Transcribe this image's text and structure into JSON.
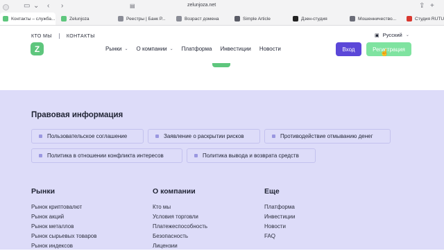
{
  "browser": {
    "url": "zelunjoza.net",
    "tabs": [
      {
        "label": "Контакты – служба...",
        "color": "#5ec67d",
        "active": true
      },
      {
        "label": "Zelunjoza",
        "color": "#5ec67d",
        "active": false
      },
      {
        "label": "Реестры | Банк Р...",
        "color": "#8a8c96",
        "active": false
      },
      {
        "label": "Возраст домена",
        "color": "#8a8c96",
        "active": false
      },
      {
        "label": "Simple Article",
        "color": "#5a5c66",
        "active": false
      },
      {
        "label": "Дзен-студия",
        "color": "#222222",
        "active": false
      },
      {
        "label": "Мошенничество...",
        "color": "#6b6d78",
        "active": false
      },
      {
        "label": "Студия RUTUBE",
        "color": "#d8372f",
        "active": false
      }
    ]
  },
  "header": {
    "topnav": {
      "about": "КТО МЫ",
      "contacts": "КОНТАКТЫ"
    },
    "language": "Русский",
    "nav": [
      {
        "label": "Рынки",
        "has_dropdown": true
      },
      {
        "label": "О компании",
        "has_dropdown": true
      },
      {
        "label": "Платформа",
        "has_dropdown": false
      },
      {
        "label": "Инвестиции",
        "has_dropdown": false
      },
      {
        "label": "Новости",
        "has_dropdown": false
      }
    ],
    "login": "Вход",
    "register": "Регистрация"
  },
  "legal": {
    "title": "Правовая информация",
    "row1": [
      "Пользовательское соглашение",
      "Заявление о раскрытии рисков",
      "Противодействие отмыванию денег"
    ],
    "row2": [
      "Политика в отношении конфликта интересов",
      "Политика вывода и возврата средств"
    ]
  },
  "footer": {
    "columns": [
      {
        "title": "Рынки",
        "links": [
          "Рынок криптовалют",
          "Рынок акций",
          "Рынок металлов",
          "Рынок сырьевых товаров",
          "Рынок индексов"
        ]
      },
      {
        "title": "О компании",
        "links": [
          "Кто мы",
          "Условия торговли",
          "Платежеспособность",
          "Безопасность",
          "Лицензии"
        ]
      },
      {
        "title": "Еще",
        "links": [
          "Платформа",
          "Инвестиции",
          "Новости",
          "FAQ"
        ]
      }
    ]
  },
  "colors": {
    "brand_green": "#5ec67d",
    "login_purple": "#5b47d8",
    "register_green": "#7fe3a0",
    "legal_bg": "#dddcf9"
  }
}
